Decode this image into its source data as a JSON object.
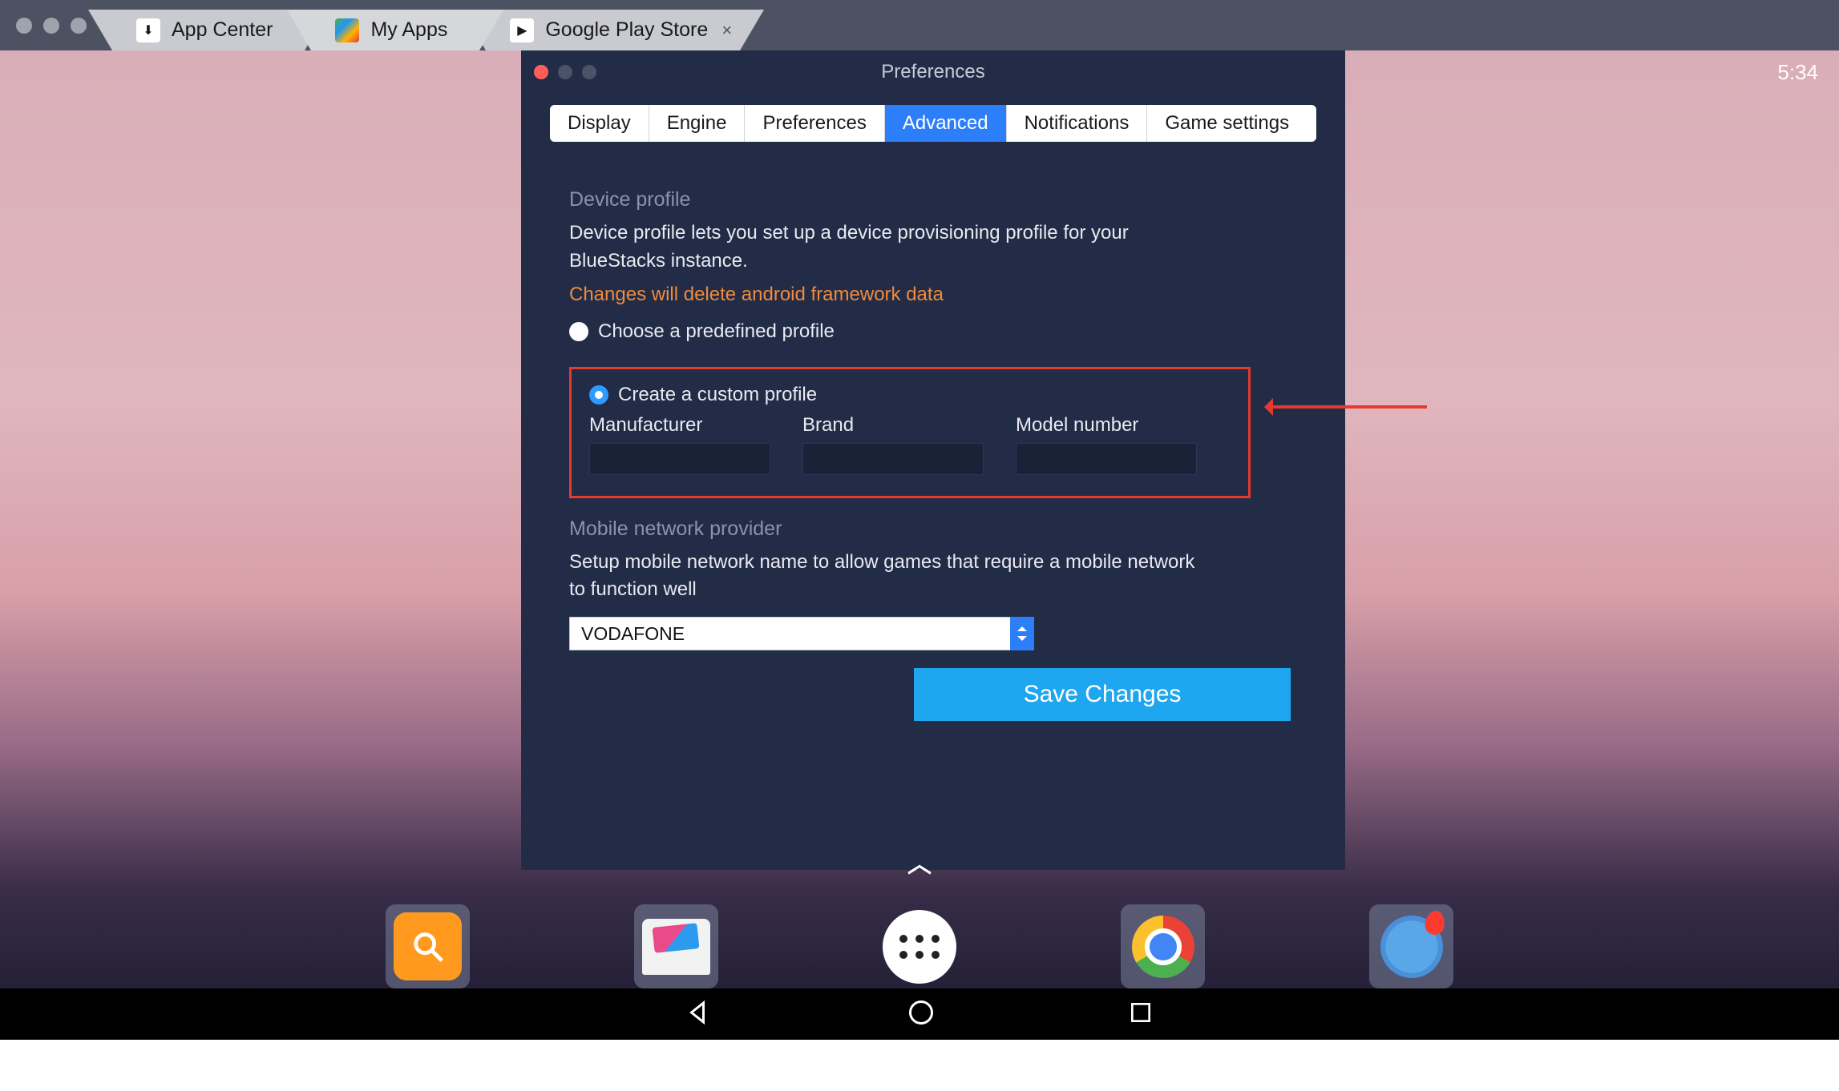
{
  "window_tabs": [
    {
      "label": "App Center",
      "icon": "app-center"
    },
    {
      "label": "My Apps",
      "icon": "bluestacks"
    },
    {
      "label": "Google Play Store",
      "icon": "play-store",
      "closable": true
    }
  ],
  "status": {
    "time": "5:34"
  },
  "modal": {
    "title": "Preferences",
    "tabs": [
      "Display",
      "Engine",
      "Preferences",
      "Advanced",
      "Notifications",
      "Game settings"
    ],
    "active_tab": "Advanced",
    "device_profile": {
      "heading": "Device profile",
      "description": "Device profile lets you set up a device provisioning profile for your BlueStacks instance.",
      "warning": "Changes will delete android framework data",
      "option_predefined": "Choose a predefined profile",
      "option_custom": "Create a custom profile",
      "selected": "custom",
      "fields": {
        "manufacturer_label": "Manufacturer",
        "manufacturer_value": "",
        "brand_label": "Brand",
        "brand_value": "",
        "model_label": "Model number",
        "model_value": ""
      }
    },
    "network": {
      "heading": "Mobile network provider",
      "description": "Setup mobile network name to allow games that require a mobile network to function well",
      "selected": "VODAFONE"
    },
    "save_label": "Save Changes"
  },
  "dock": {
    "items": [
      "search",
      "gallery",
      "all-apps",
      "chrome",
      "maps"
    ]
  }
}
